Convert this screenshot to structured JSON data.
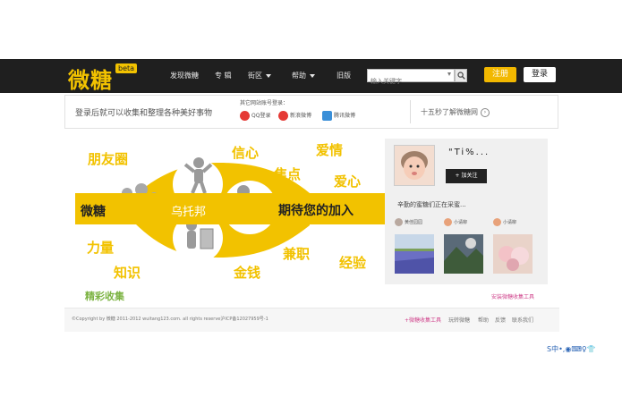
{
  "header": {
    "logo": "微糖",
    "beta_badge": "beta",
    "nav_items": [
      {
        "label": "发现微糖",
        "has_caret": false
      },
      {
        "label": "专 辑",
        "has_caret": false
      },
      {
        "label": "街区",
        "has_caret": true
      },
      {
        "label": "帮助",
        "has_caret": true
      },
      {
        "label": "旧版",
        "has_caret": false
      }
    ],
    "search_placeholder": "输入关键字",
    "register_label": "注册",
    "login_label": "登录"
  },
  "login_strip": {
    "tagline": "登录后就可以收集和整理各种美好事物",
    "other_login_label": "其它网站账号登录：",
    "options": [
      {
        "label": "QQ登录",
        "icon": "qq-icon",
        "color": "#e53935"
      },
      {
        "label": "新浪微博",
        "icon": "weibo-icon",
        "color": "#e53935"
      },
      {
        "label": "腾讯微博",
        "icon": "tencent-weibo-icon",
        "color": "#3a8fd8"
      }
    ],
    "learn_more": "十五秒了解微糖网"
  },
  "hero": {
    "keywords": [
      "朋友圈",
      "信心",
      "爱情",
      "焦点",
      "爱心",
      "力量",
      "知识",
      "金钱",
      "兼职",
      "经验"
    ],
    "banner_left": "微糖",
    "banner_center": "乌托邦",
    "banner_right": "期待您的加入",
    "collect_label": "精彩收集"
  },
  "card": {
    "username": "\"Ti%...",
    "follow_label": "+ 加关注",
    "collecting_text": "辛勤的蜜糖们正在采蜜...",
    "recent_users": [
      "黄佳园园",
      "小请柳",
      "小请柳"
    ],
    "install_link": "安装微糖收集工具"
  },
  "footer": {
    "copyright": "©Copyright by 微糖 2011-2012 wuitang123.com. all rights reserve沪ICP备12027959号-1",
    "links": [
      "+微糖收集工具",
      "玩转微糖",
      "帮助",
      "反馈",
      "联系我们"
    ]
  },
  "tray": {
    "text": "S中•,◉⌨♀👕"
  },
  "colors": {
    "accent": "#f2c200",
    "nav_bg": "#1f1f1f",
    "register": "#f2b800",
    "collect_green": "#7cb342",
    "link_pink": "#d0458d"
  }
}
